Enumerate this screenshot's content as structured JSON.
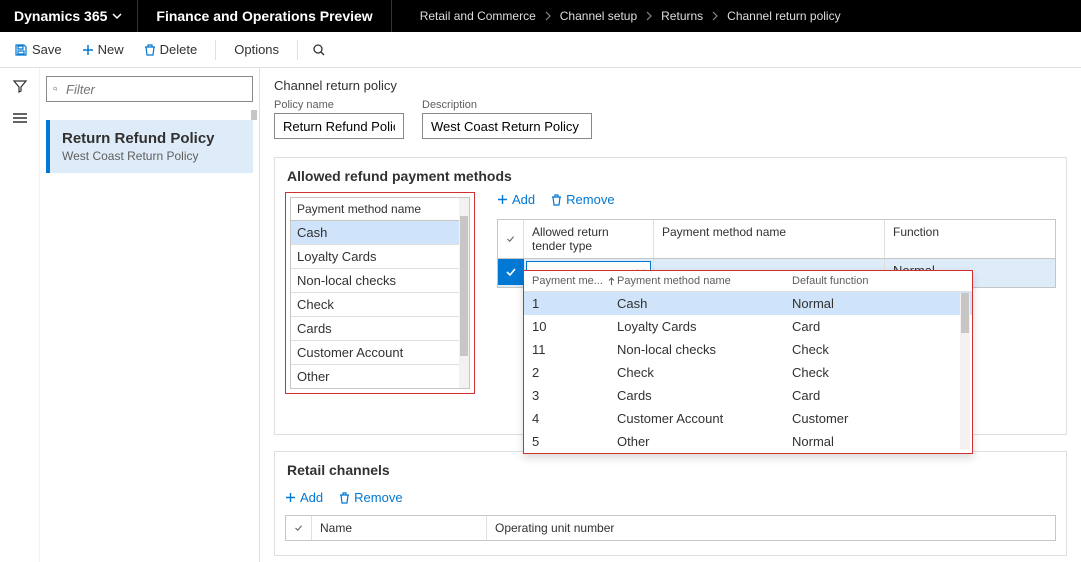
{
  "topbar": {
    "brand": "Dynamics 365",
    "module": "Finance and Operations Preview",
    "breadcrumbs": [
      "Retail and Commerce",
      "Channel setup",
      "Returns",
      "Channel return policy"
    ]
  },
  "commands": {
    "save": "Save",
    "new": "New",
    "delete": "Delete",
    "options": "Options"
  },
  "filter": {
    "placeholder": "Filter"
  },
  "listpane": {
    "item_title": "Return Refund Policy",
    "item_sub": "West Coast Return Policy"
  },
  "page": {
    "title": "Channel return policy"
  },
  "fields": {
    "policy_name_label": "Policy name",
    "policy_name_value": "Return Refund Policy",
    "description_label": "Description",
    "description_value": "West Coast Return Policy"
  },
  "allowed": {
    "section_title": "Allowed refund payment methods",
    "pm_header": "Payment method name",
    "pm_list": [
      "Cash",
      "Loyalty Cards",
      "Non-local checks",
      "Check",
      "Cards",
      "Customer Account",
      "Other"
    ],
    "add": "Add",
    "remove": "Remove",
    "grid_headers": {
      "tender": "Allowed return tender type",
      "pmname": "Payment method name",
      "function": "Function"
    },
    "grid_row": {
      "function": "Normal"
    },
    "dropdown": {
      "h1": "Payment me...",
      "h2": "Payment method name",
      "h3": "Default function",
      "rows": [
        {
          "id": "1",
          "name": "Cash",
          "fn": "Normal"
        },
        {
          "id": "10",
          "name": "Loyalty Cards",
          "fn": "Card"
        },
        {
          "id": "11",
          "name": "Non-local checks",
          "fn": "Check"
        },
        {
          "id": "2",
          "name": "Check",
          "fn": "Check"
        },
        {
          "id": "3",
          "name": "Cards",
          "fn": "Card"
        },
        {
          "id": "4",
          "name": "Customer Account",
          "fn": "Customer"
        },
        {
          "id": "5",
          "name": "Other",
          "fn": "Normal"
        }
      ]
    }
  },
  "retail": {
    "section_title": "Retail channels",
    "add": "Add",
    "remove": "Remove",
    "grid_headers": {
      "name": "Name",
      "oun": "Operating unit number"
    }
  }
}
